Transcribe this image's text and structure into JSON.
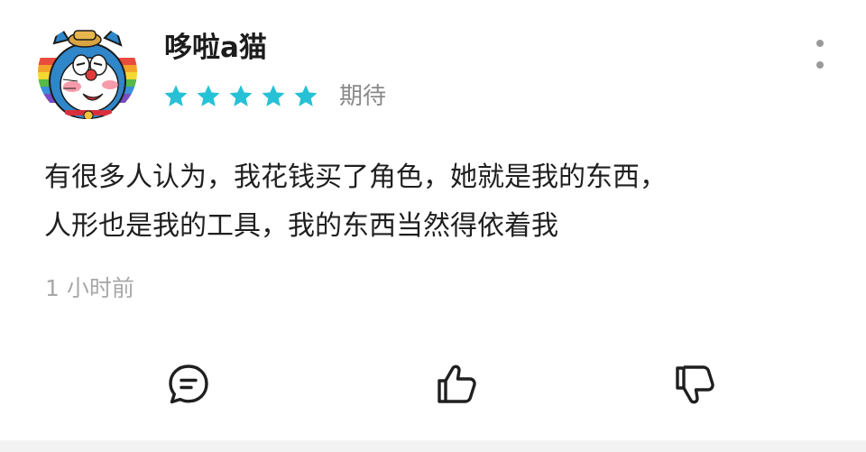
{
  "review": {
    "user": {
      "name": "哆啦a猫",
      "avatar_icon": "doraemon-avatar"
    },
    "rating": {
      "stars": 5,
      "max_stars": 5,
      "label": "期待",
      "star_color": "#27c1d6"
    },
    "text_lines": [
      "有很多人认为，我花钱买了角色，她就是我的东西，",
      "人形也是我的工具，我的东西当然得依着我"
    ],
    "timestamp": "1 小时前",
    "actions": {
      "comment_icon": "comment-icon",
      "like_icon": "thumbs-up-icon",
      "dislike_icon": "thumbs-down-icon"
    },
    "more_icon": "more-vertical-icon"
  }
}
